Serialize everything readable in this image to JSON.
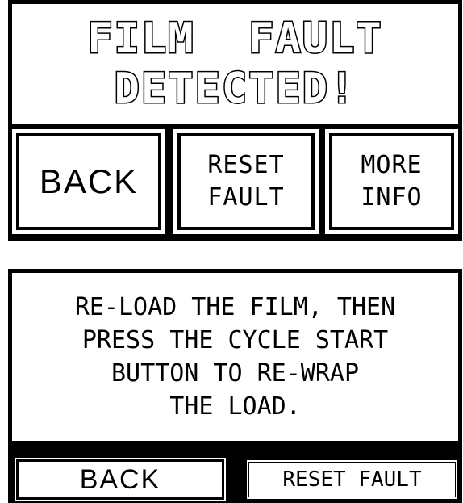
{
  "screen_1": {
    "message_lines": [
      "FILM  FAULT",
      "DETECTED!"
    ],
    "buttons": {
      "back": "BACK",
      "reset_fault_line1": "RESET",
      "reset_fault_line2": "FAULT",
      "more_info_line1": "MORE",
      "more_info_line2": "INFO"
    }
  },
  "screen_2": {
    "message_lines": [
      "RE-LOAD THE FILM, THEN",
      "PRESS THE CYCLE START",
      "BUTTON TO RE-WRAP",
      "THE LOAD."
    ],
    "buttons": {
      "back": "BACK",
      "reset_fault": "RESET FAULT"
    }
  },
  "colors": {
    "background": "#000000",
    "panel": "#ffffff",
    "text": "#000000"
  }
}
